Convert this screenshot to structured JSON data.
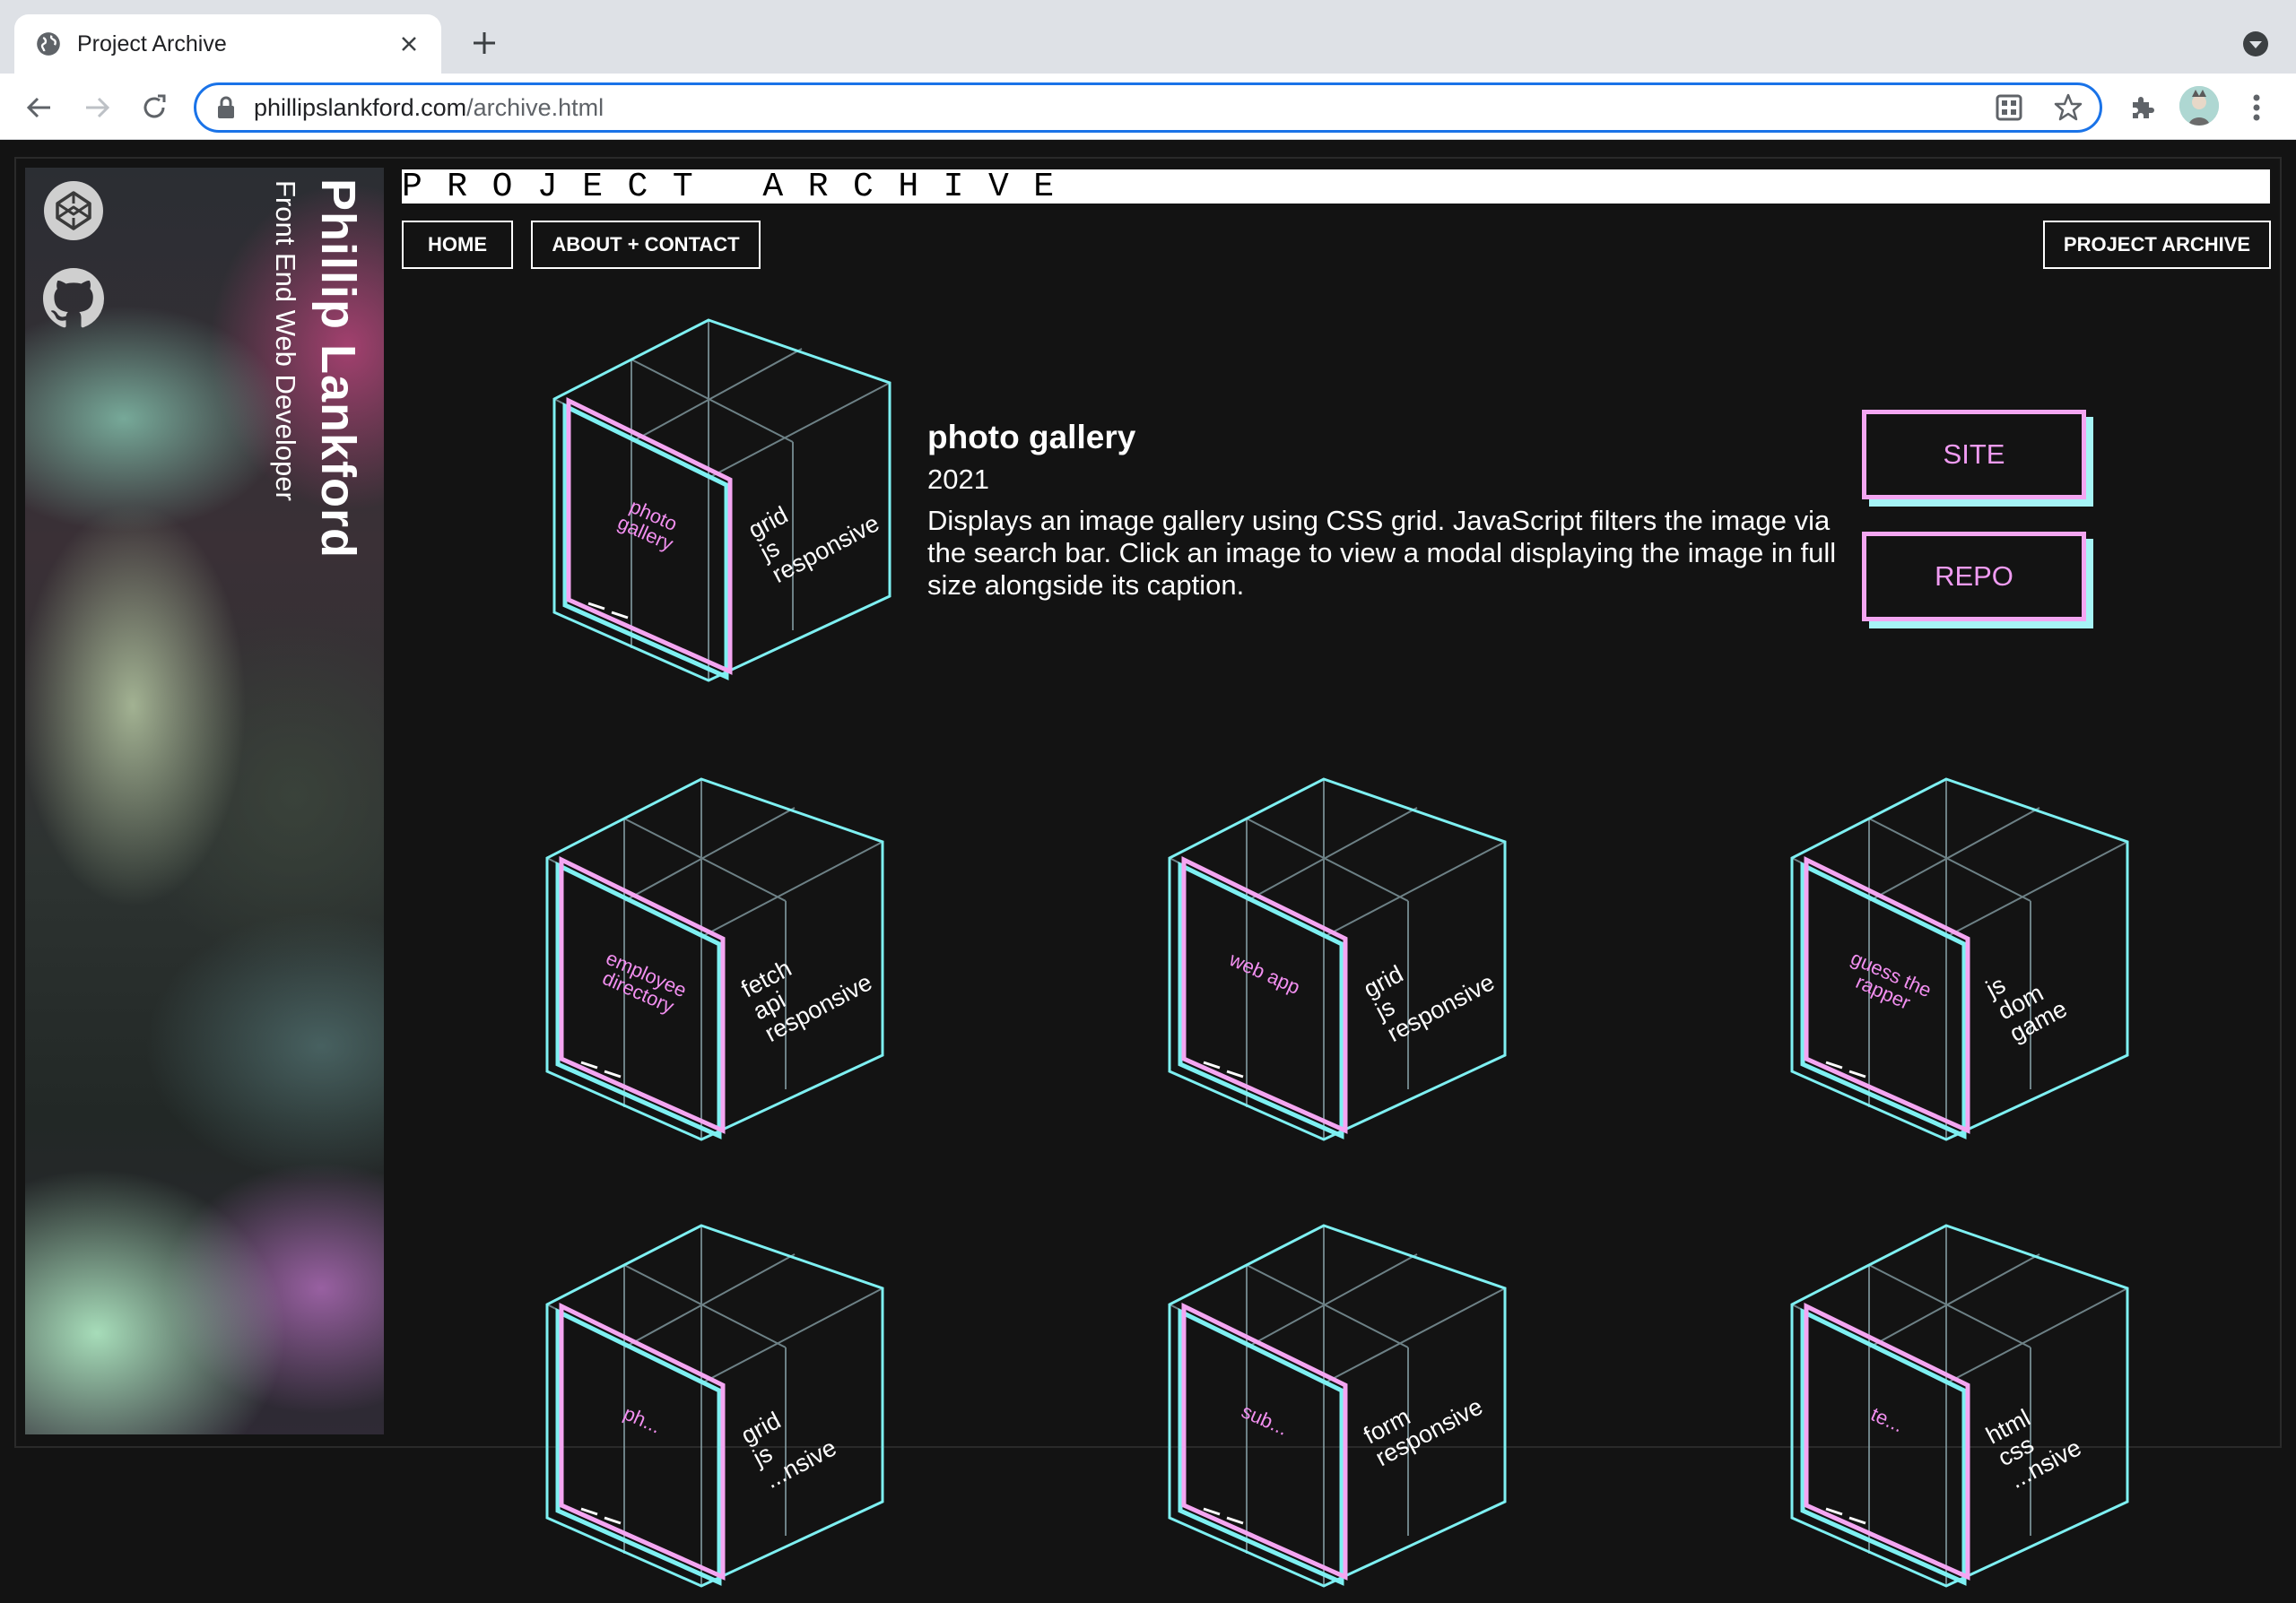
{
  "browser": {
    "tab_title": "Project Archive",
    "url_domain": "phillipslankford.com",
    "url_path": "/archive.html"
  },
  "sidebar": {
    "name": "Phillip Lankford",
    "role": "Front End Web Developer",
    "icons": [
      "codepen-icon",
      "github-icon"
    ]
  },
  "header": {
    "banner": "PROJECT ARCHIVE",
    "nav": {
      "home": "HOME",
      "about": "ABOUT + CONTACT",
      "archive": "PROJECT ARCHIVE"
    }
  },
  "featured": {
    "title": "photo gallery",
    "year": "2021",
    "description": "Displays an image gallery using CSS grid. JavaScript filters the image via the search bar. Click an image to view a modal displaying the image in full size alongside its caption.",
    "site_label": "SITE",
    "repo_label": "REPO",
    "cube": {
      "label": "photo gallery",
      "tags": [
        "grid",
        "js",
        "responsive"
      ]
    }
  },
  "projects": [
    {
      "label": "employee directory",
      "tags": [
        "fetch",
        "api",
        "responsive"
      ]
    },
    {
      "label": "web app",
      "tags": [
        "grid",
        "js",
        "responsive"
      ]
    },
    {
      "label": "guess the rapper",
      "tags": [
        "js",
        "dom",
        "game"
      ]
    },
    {
      "label": "ph...",
      "tags": [
        "grid",
        "js",
        "...nsive"
      ]
    },
    {
      "label": "sub...",
      "tags": [
        "form",
        "responsive"
      ]
    },
    {
      "label": "te...",
      "tags": [
        "html",
        "css",
        "...nsive"
      ]
    }
  ],
  "colors": {
    "accent_pink": "#f4a6f2",
    "accent_cyan": "#a6f4f6",
    "background": "#131313"
  }
}
